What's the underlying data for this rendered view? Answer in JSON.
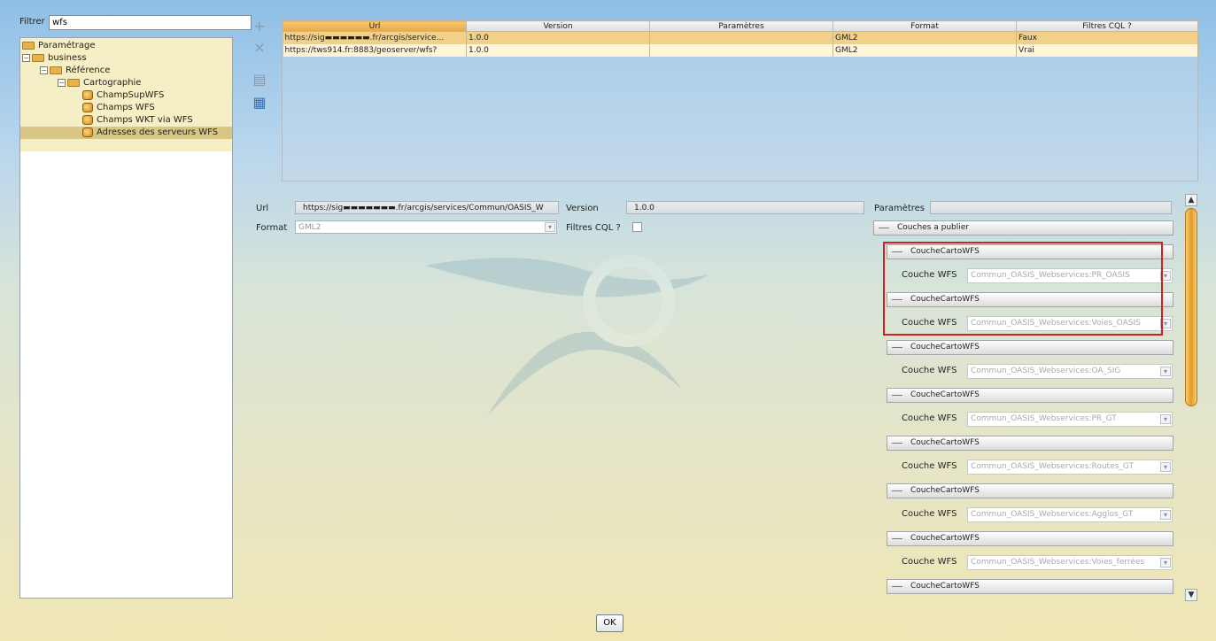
{
  "filter": {
    "label": "Filtrer",
    "value": "wfs"
  },
  "tree": [
    {
      "label": "Paramétrage",
      "icon": "folder-icon",
      "expander": ""
    },
    {
      "label": "business",
      "icon": "folder-icon",
      "expander": "−"
    },
    {
      "label": "Référence",
      "icon": "folder-icon",
      "expander": "−"
    },
    {
      "label": "Cartographie",
      "icon": "folder-icon",
      "expander": "−"
    },
    {
      "label": "ChampSupWFS",
      "icon": "leaf-icon",
      "expander": ""
    },
    {
      "label": "Champs WFS",
      "icon": "leaf-icon",
      "expander": ""
    },
    {
      "label": "Champs WKT via WFS",
      "icon": "leaf-icon",
      "expander": ""
    },
    {
      "label": "Adresses des serveurs WFS",
      "icon": "leaf-icon",
      "expander": "",
      "selected": true
    }
  ],
  "toolbar": {
    "add_icon": "+",
    "delete_icon": "×",
    "copy_icon": "▤",
    "paste_icon": "▦"
  },
  "table": {
    "columns": [
      "Url",
      "Version",
      "Paramètres",
      "Format",
      "Filtres CQL ?"
    ],
    "rows": [
      [
        "https://sig▬▬▬▬▬▬.fr/arcgis/service...",
        "1.0.0",
        "",
        "GML2",
        "Faux"
      ],
      [
        "https://tws914.fr:8883/geoserver/wfs?",
        "1.0.0",
        "",
        "GML2",
        "Vrai"
      ]
    ]
  },
  "form": {
    "url_label": "Url",
    "url_value": "https://sig▬▬▬▬▬▬▬.fr/arcgis/services/Commun/OASIS_W",
    "version_label": "Version",
    "version_value": "1.0.0",
    "format_label": "Format",
    "format_value": "GML2",
    "cql_label": "Filtres CQL ?",
    "params_label": "Paramètres"
  },
  "layers": {
    "section_title": "Couches a publier",
    "item_title": "CoucheCartoWFS",
    "field_label": "Couche WFS",
    "items": [
      "Commun_OASIS_Webservices:PR_OASIS",
      "Commun_OASIS_Webservices:Voies_OASIS",
      "Commun_OASIS_Webservices:OA_SIG",
      "Commun_OASIS_Webservices:PR_GT",
      "Commun_OASIS_Webservices:Routes_GT",
      "Commun_OASIS_Webservices:Agglos_GT",
      "Commun_OASIS_Webservices:Voies_ferrées",
      ""
    ]
  },
  "ok_label": "OK",
  "colors": {
    "highlight_box": "#d21f1f",
    "selection": "#f2d088",
    "scroll_thumb": "#e29a2a"
  }
}
